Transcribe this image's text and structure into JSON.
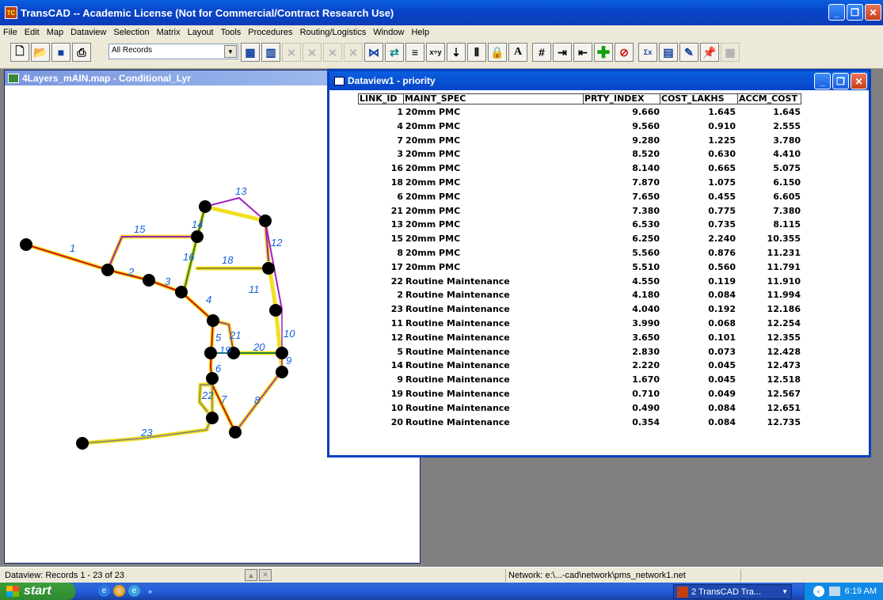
{
  "app": {
    "title": "TransCAD -- Academic License (Not for Commercial/Contract Research Use)",
    "icon": "transcad-app-icon"
  },
  "menubar": [
    "File",
    "Edit",
    "Map",
    "Dataview",
    "Selection",
    "Matrix",
    "Layout",
    "Tools",
    "Procedures",
    "Routing/Logistics",
    "Window",
    "Help"
  ],
  "toolbar": {
    "selection_combo": "All Records"
  },
  "map_window": {
    "title": "4Layers_mAIN.map - Conditional_Lyr",
    "link_labels": [
      "1",
      "2",
      "3",
      "4",
      "5",
      "6",
      "7",
      "8",
      "9",
      "10",
      "11",
      "12",
      "13",
      "14",
      "15",
      "16",
      "18",
      "19",
      "20",
      "21",
      "22",
      "23"
    ],
    "colors": {
      "red": "#d01010",
      "yellow": "#f0e020",
      "purple": "#a020c0",
      "green": "#208040",
      "gray": "#909090",
      "node": "#000000",
      "label": "#1060e0"
    }
  },
  "dataview": {
    "title": "Dataview1 - priority",
    "columns": [
      "LINK_ID",
      "MAINT_SPEC",
      "PRTY_INDEX",
      "COST_LAKHS",
      "ACCM_COST"
    ],
    "rows": [
      {
        "link_id": "1",
        "maint_spec": "20mm PMC",
        "prty_index": "9.660",
        "cost_lakhs": "1.645",
        "accm_cost": "1.645"
      },
      {
        "link_id": "4",
        "maint_spec": "20mm PMC",
        "prty_index": "9.560",
        "cost_lakhs": "0.910",
        "accm_cost": "2.555"
      },
      {
        "link_id": "7",
        "maint_spec": "20mm PMC",
        "prty_index": "9.280",
        "cost_lakhs": "1.225",
        "accm_cost": "3.780"
      },
      {
        "link_id": "3",
        "maint_spec": "20mm PMC",
        "prty_index": "8.520",
        "cost_lakhs": "0.630",
        "accm_cost": "4.410"
      },
      {
        "link_id": "16",
        "maint_spec": "20mm PMC",
        "prty_index": "8.140",
        "cost_lakhs": "0.665",
        "accm_cost": "5.075"
      },
      {
        "link_id": "18",
        "maint_spec": "20mm PMC",
        "prty_index": "7.870",
        "cost_lakhs": "1.075",
        "accm_cost": "6.150"
      },
      {
        "link_id": "6",
        "maint_spec": "20mm PMC",
        "prty_index": "7.650",
        "cost_lakhs": "0.455",
        "accm_cost": "6.605"
      },
      {
        "link_id": "21",
        "maint_spec": "20mm PMC",
        "prty_index": "7.380",
        "cost_lakhs": "0.775",
        "accm_cost": "7.380"
      },
      {
        "link_id": "13",
        "maint_spec": "20mm PMC",
        "prty_index": "6.530",
        "cost_lakhs": "0.735",
        "accm_cost": "8.115"
      },
      {
        "link_id": "15",
        "maint_spec": "20mm PMC",
        "prty_index": "6.250",
        "cost_lakhs": "2.240",
        "accm_cost": "10.355"
      },
      {
        "link_id": "8",
        "maint_spec": "20mm PMC",
        "prty_index": "5.560",
        "cost_lakhs": "0.876",
        "accm_cost": "11.231"
      },
      {
        "link_id": "17",
        "maint_spec": "20mm PMC",
        "prty_index": "5.510",
        "cost_lakhs": "0.560",
        "accm_cost": "11.791"
      },
      {
        "link_id": "22",
        "maint_spec": "Routine Maintenance",
        "prty_index": "4.550",
        "cost_lakhs": "0.119",
        "accm_cost": "11.910"
      },
      {
        "link_id": "2",
        "maint_spec": "Routine Maintenance",
        "prty_index": "4.180",
        "cost_lakhs": "0.084",
        "accm_cost": "11.994"
      },
      {
        "link_id": "23",
        "maint_spec": "Routine Maintenance",
        "prty_index": "4.040",
        "cost_lakhs": "0.192",
        "accm_cost": "12.186"
      },
      {
        "link_id": "11",
        "maint_spec": "Routine Maintenance",
        "prty_index": "3.990",
        "cost_lakhs": "0.068",
        "accm_cost": "12.254"
      },
      {
        "link_id": "12",
        "maint_spec": "Routine Maintenance",
        "prty_index": "3.650",
        "cost_lakhs": "0.101",
        "accm_cost": "12.355"
      },
      {
        "link_id": "5",
        "maint_spec": "Routine Maintenance",
        "prty_index": "2.830",
        "cost_lakhs": "0.073",
        "accm_cost": "12.428"
      },
      {
        "link_id": "14",
        "maint_spec": "Routine Maintenance",
        "prty_index": "2.220",
        "cost_lakhs": "0.045",
        "accm_cost": "12.473"
      },
      {
        "link_id": "9",
        "maint_spec": "Routine Maintenance",
        "prty_index": "1.670",
        "cost_lakhs": "0.045",
        "accm_cost": "12.518"
      },
      {
        "link_id": "19",
        "maint_spec": "Routine Maintenance",
        "prty_index": "0.710",
        "cost_lakhs": "0.049",
        "accm_cost": "12.567"
      },
      {
        "link_id": "10",
        "maint_spec": "Routine Maintenance",
        "prty_index": "0.490",
        "cost_lakhs": "0.084",
        "accm_cost": "12.651"
      },
      {
        "link_id": "20",
        "maint_spec": "Routine Maintenance",
        "prty_index": "0.354",
        "cost_lakhs": "0.084",
        "accm_cost": "12.735"
      }
    ]
  },
  "statusbar": {
    "records": "Dataview: Records 1 - 23 of 23",
    "network": "Network: e:\\...-cad\\network\\pms_network1.net"
  },
  "taskbar": {
    "start_label": "start",
    "task_label": "2 TransCAD Tra...",
    "clock": "6:19 AM"
  }
}
